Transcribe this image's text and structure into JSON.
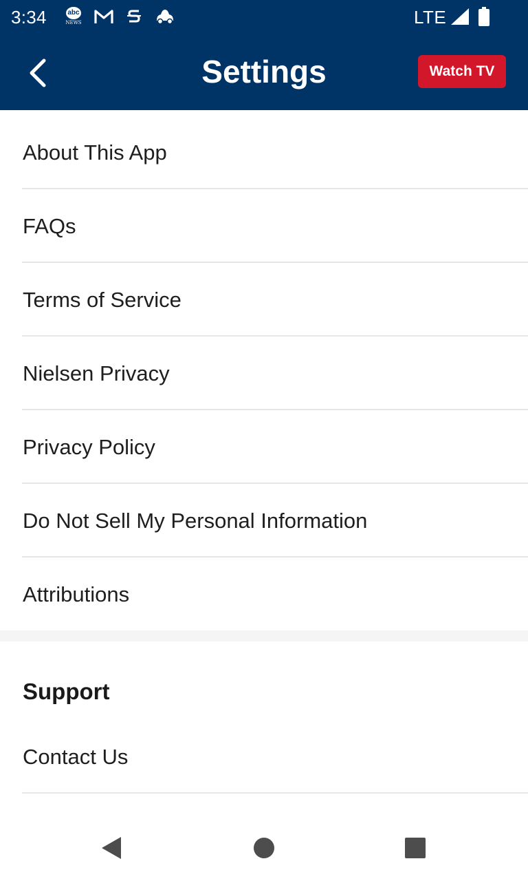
{
  "status_bar": {
    "time": "3:34",
    "network": "LTE",
    "notifications": [
      {
        "icon": "abc-news-icon",
        "text": "abc",
        "subtext": "NEWS"
      },
      {
        "icon": "gmail-icon"
      },
      {
        "icon": "s-app-icon"
      },
      {
        "icon": "car-app-icon"
      }
    ]
  },
  "header": {
    "title": "Settings",
    "back_icon": "chevron-left-icon",
    "watch_tv_label": "Watch TV"
  },
  "settings_items": [
    {
      "label": "About This App"
    },
    {
      "label": "FAQs"
    },
    {
      "label": "Terms of Service"
    },
    {
      "label": "Nielsen Privacy"
    },
    {
      "label": "Privacy Policy"
    },
    {
      "label": "Do Not Sell My Personal Information"
    },
    {
      "label": "Attributions"
    }
  ],
  "support": {
    "title": "Support",
    "items": [
      {
        "label": "Contact Us"
      }
    ]
  },
  "nav_bar": {
    "buttons": [
      "back-triangle-icon",
      "home-circle-icon",
      "recents-square-icon"
    ]
  },
  "colors": {
    "header_bg": "#003366",
    "watch_tv_bg": "#d3172b",
    "text": "#1e1e1e",
    "divider": "#e6e6e6"
  }
}
